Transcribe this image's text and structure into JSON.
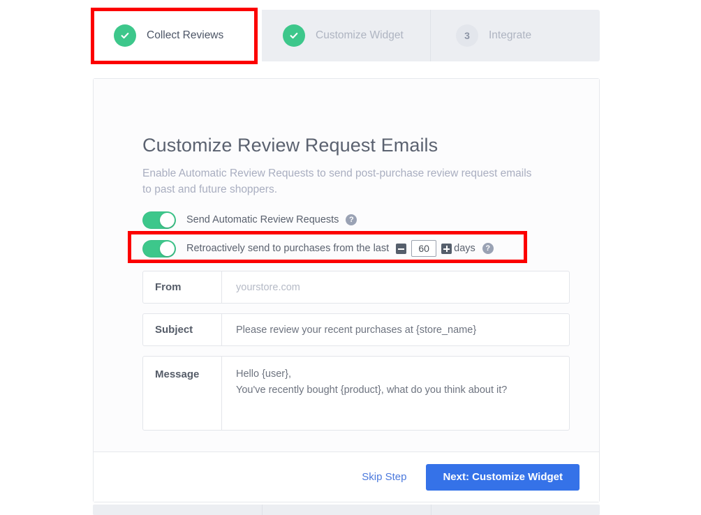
{
  "wizard": {
    "steps": [
      {
        "label": "Collect Reviews",
        "state": "done",
        "icon": "check-icon",
        "number": "1",
        "active": true
      },
      {
        "label": "Customize Widget",
        "state": "done",
        "icon": "check-icon",
        "number": "2",
        "active": false
      },
      {
        "label": "Integrate",
        "state": "todo",
        "icon": "",
        "number": "3",
        "active": false
      }
    ]
  },
  "main": {
    "title": "Customize Review Request Emails",
    "subtitle": "Enable Automatic Review Requests to send post-purchase review request emails to past and future shoppers.",
    "toggles": {
      "automatic": {
        "label": "Send Automatic Review Requests",
        "state": "on",
        "help_icon": "help-circle-icon",
        "help_glyph": "?"
      },
      "retroactive": {
        "label": "Retroactively send to purchases from the last",
        "state": "on",
        "days_value": "60",
        "days_placeholder": "60",
        "days_suffix": "days",
        "decrement_icon": "minus-square-icon",
        "increment_icon": "plus-square-icon",
        "help_icon": "help-circle-icon",
        "help_glyph": "?"
      }
    },
    "fields": [
      {
        "label": "From",
        "value": "yourstore.com",
        "is_placeholder": true,
        "placeholder": "yourstore.com"
      },
      {
        "label": "Subject",
        "value": "Please review your recent purchases at {store_name}",
        "is_placeholder": false,
        "placeholder": "Please review your recent purchases at {store_name}"
      },
      {
        "label": "Message",
        "value": "Hello {user},\nYou've recently bought {product}, what do you think about it?",
        "is_placeholder": false,
        "placeholder": "Hello {user},"
      }
    ]
  },
  "footer": {
    "skip_label": "Skip Step",
    "next_label": "Next: Customize Widget"
  },
  "colors": {
    "accent_green": "#3dc78b",
    "accent_blue": "#3572e8",
    "link_blue": "#4b79dd",
    "annotation_red": "#fc0000",
    "header_bg": "#eceef2",
    "muted_text": "#aeb4c1"
  }
}
